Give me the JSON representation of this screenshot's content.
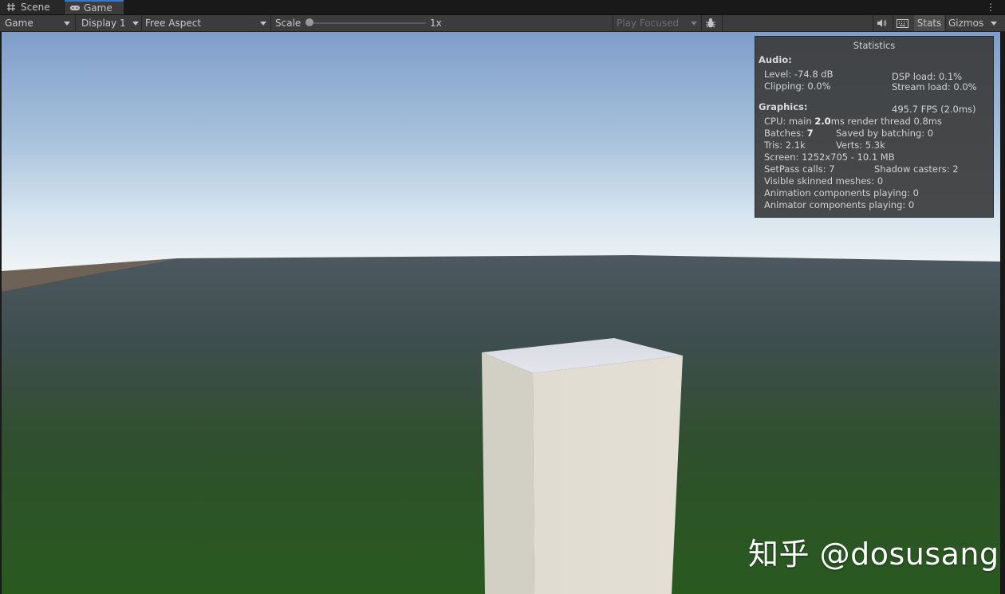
{
  "tabs": [
    {
      "label": "Scene",
      "icon": "grid-icon"
    },
    {
      "label": "Game",
      "icon": "gamepad-icon"
    }
  ],
  "toolbar": {
    "view_mode": "Game",
    "display": "Display 1",
    "aspect": "Free Aspect",
    "scale_label": "Scale",
    "scale_value": "1x",
    "play_mode": "Play Focused",
    "stats_label": "Stats",
    "gizmos_label": "Gizmos"
  },
  "stats": {
    "title": "Statistics",
    "audio_header": "Audio:",
    "level": "Level: -74.8 dB",
    "dsp_load": "DSP load: 0.1%",
    "clipping": "Clipping: 0.0%",
    "stream_load": "Stream load: 0.0%",
    "graphics_header": "Graphics:",
    "fps": "495.7 FPS (2.0ms)",
    "cpu_prefix": "CPU: main",
    "cpu_main": "2.0",
    "cpu_suffix": "ms  render thread 0.8ms",
    "batches_prefix": "Batches:",
    "batches": "7",
    "saved_by_batching": "Saved by batching: 0",
    "tris": "Tris: 2.1k",
    "verts": "Verts: 5.3k",
    "screen": "Screen: 1252x705 - 10.1 MB",
    "setpass": "SetPass calls: 7",
    "shadow_casters": "Shadow casters: 2",
    "skinned_meshes": "Visible skinned meshes: 0",
    "animation_components": "Animation components playing: 0",
    "animator_components": "Animator components playing: 0"
  },
  "watermark": "知乎 @dosusang",
  "colors": {
    "accent": "#3a79bb",
    "sky_top": "#7d9cc9",
    "horizon": "#e8eef2",
    "ground_far": "#4a5660",
    "ground_near": "#2a5a1e",
    "cube": "#e4e0d6"
  }
}
